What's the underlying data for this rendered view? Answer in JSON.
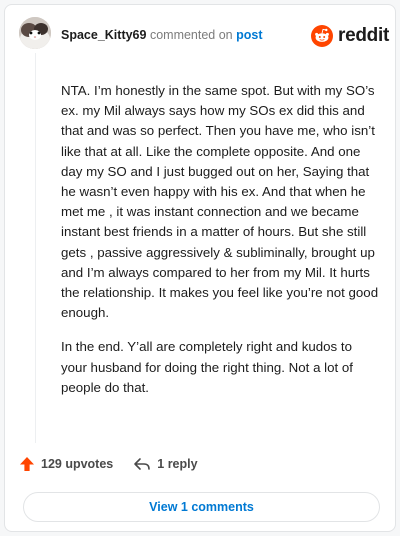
{
  "comment": {
    "username": "Space_Kitty69",
    "meta_text": "commented on",
    "post_link": "post",
    "paragraphs": [
      "NTA. I’m honestly in the same spot. But with my SO’s ex. my Mil always says how my SOs ex did this and that and was so perfect. Then you have me, who isn’t like that at all. Like the complete opposite. And one day my SO and I just bugged out on her, Saying that he wasn’t even happy with his ex. And that when he met me , it was instant connection and we became instant best friends in a matter of hours. But she still gets , passive aggressively & subliminally, brought up and I’m always compared to her from my Mil. It hurts the relationship. It makes you feel like you’re not good enough.",
      "In the end. Y’all are completely right and kudos to your husband for doing the right thing. Not a lot of people do that."
    ]
  },
  "brand": {
    "name": "reddit",
    "icon": "reddit-snoo-icon",
    "color": "#ff4500"
  },
  "actions": {
    "upvotes": "129 upvotes",
    "upvote_icon": "upvote-arrow-icon",
    "upvote_color": "#ff4500",
    "reply": "1 reply",
    "reply_icon": "reply-arrow-icon"
  },
  "view_comments": "View 1 comments",
  "colors": {
    "link": "#0079d3",
    "text": "#1c1c1c",
    "muted": "#7c7c7c"
  }
}
